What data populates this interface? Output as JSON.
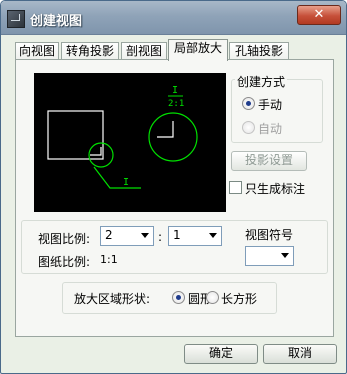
{
  "window": {
    "title": "创建视图",
    "close_label": "✕"
  },
  "tabs": [
    {
      "label": "向视图"
    },
    {
      "label": "转角投影"
    },
    {
      "label": "剖视图"
    },
    {
      "label": "局部放大"
    },
    {
      "label": "孔轴投影"
    }
  ],
  "active_tab": "局部放大",
  "preview": {
    "callout_label": "I",
    "scale_numerator": "I",
    "scale_denominator": "2:1"
  },
  "create_method": {
    "title": "创建方式",
    "options": [
      {
        "label": "手动",
        "checked": true,
        "enabled": true
      },
      {
        "label": "自动",
        "checked": false,
        "enabled": false
      }
    ]
  },
  "projection_settings_label": "投影设置",
  "only_generate_label": {
    "label": "只生成标注",
    "checked": false
  },
  "scale": {
    "view_scale_label": "视图比例:",
    "view_scale_left": "2",
    "separator": ":",
    "view_scale_right": "1",
    "paper_scale_label": "图纸比例:",
    "paper_scale_value": "1:1"
  },
  "view_symbol": {
    "label": "视图符号",
    "value": ""
  },
  "shape": {
    "label": "放大区域形状:",
    "options": [
      {
        "label": "圆形",
        "checked": true
      },
      {
        "label": "长方形",
        "checked": false
      }
    ]
  },
  "buttons": {
    "ok": "确定",
    "cancel": "取消"
  },
  "colors": {
    "preview_bg": "#000000",
    "preview_line": "#ffffff",
    "preview_accent": "#00e000"
  }
}
